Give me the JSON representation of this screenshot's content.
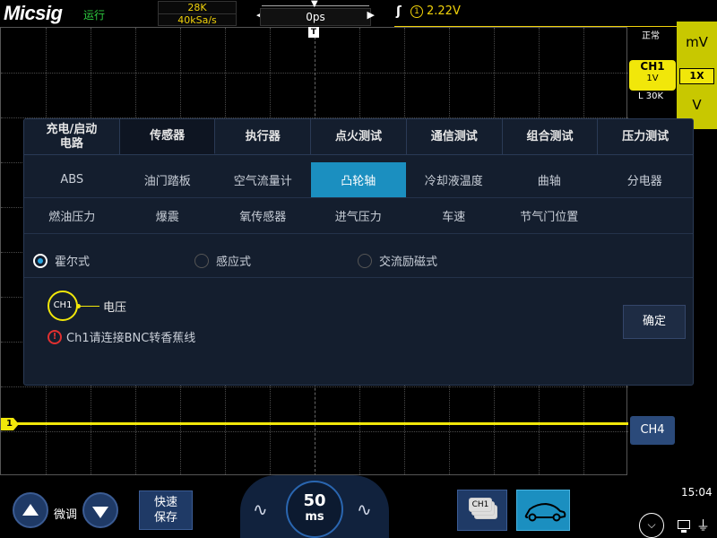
{
  "header": {
    "brand": "Micsig",
    "run_state": "运行",
    "memory_depth": "28K",
    "sample_rate": "40kSa/s",
    "horizontal_position": "0ps",
    "trigger_edge": "rising-edge-icon",
    "trigger_source": "1",
    "trigger_level": "2.22V"
  },
  "right_panel": {
    "acq_mode": "正常",
    "ch1_name": "CH1",
    "ch1_scale": "1V",
    "ch1_memory": "L 30K",
    "unit_top": "mV",
    "probe": "1X",
    "unit_bottom": "V",
    "ch4_label": "CH4"
  },
  "waveform": {
    "ch1_marker": "1",
    "trigger_marker": "T"
  },
  "dialog": {
    "tabs": [
      {
        "label": "充电/启动\n电路"
      },
      {
        "label": "传感器"
      },
      {
        "label": "执行器"
      },
      {
        "label": "点火测试"
      },
      {
        "label": "通信测试"
      },
      {
        "label": "组合测试"
      },
      {
        "label": "压力测试"
      }
    ],
    "active_tab": 1,
    "sensor_rows": [
      [
        "ABS",
        "油门踏板",
        "空气流量计",
        "凸轮轴",
        "冷却液温度",
        "曲轴",
        "分电器"
      ],
      [
        "燃油压力",
        "爆震",
        "氧传感器",
        "进气压力",
        "车速",
        "节气门位置",
        ""
      ]
    ],
    "active_sensor": "凸轮轴",
    "options": [
      {
        "label": "霍尔式",
        "selected": true
      },
      {
        "label": "感应式",
        "selected": false
      },
      {
        "label": "交流励磁式",
        "selected": false
      }
    ],
    "connection": {
      "channel": "CH1",
      "signal": "电压"
    },
    "warning": "Ch1请连接BNC转香蕉线",
    "confirm_label": "确定"
  },
  "bottom": {
    "fine_label": "微调",
    "save_label": "快速\n保存",
    "timebase_value": "50",
    "timebase_unit": "ms",
    "ch1_stack_label": "CH1",
    "clock": "15:04"
  }
}
